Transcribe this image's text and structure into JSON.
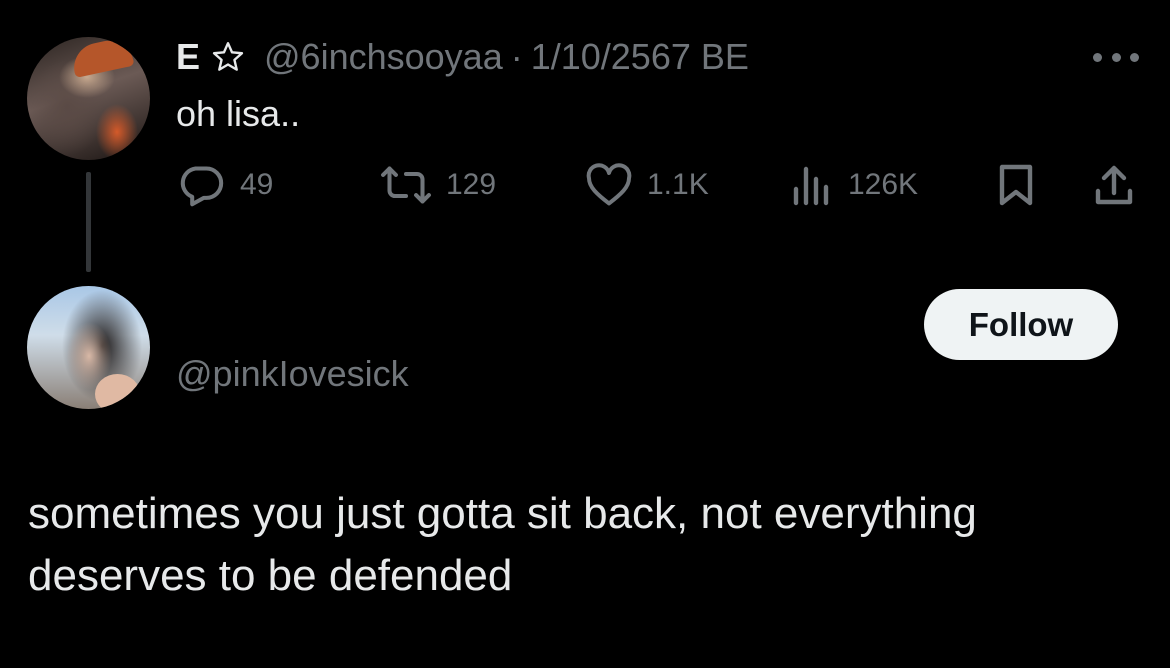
{
  "tweet": {
    "name": "E",
    "handle": "@6inchsooyaa",
    "separator": "·",
    "date": "1/10/2567 BE",
    "text": "oh lisa..",
    "stats": {
      "replies": "49",
      "reposts": "129",
      "likes": "1.1K",
      "views": "126K"
    },
    "icons": {
      "name_badge": "star-outline-icon",
      "more": "more-horizontal-icon",
      "reply": "speech-bubble-icon",
      "repost": "repost-arrows-icon",
      "like": "heart-icon",
      "views": "bar-chart-icon",
      "bookmark": "bookmark-icon",
      "share": "share-upload-icon"
    }
  },
  "reply_card": {
    "handle": "@pinkIovesick",
    "follow_label": "Follow",
    "text": "sometimes you just gotta sit back, not everything deserves to be defended"
  },
  "colors": {
    "background": "#000000",
    "primary_text": "#e7e9ea",
    "secondary_text": "#71767b",
    "follow_button_bg": "#eff3f4",
    "follow_button_text": "#0f1419",
    "thread_line": "#333639"
  }
}
